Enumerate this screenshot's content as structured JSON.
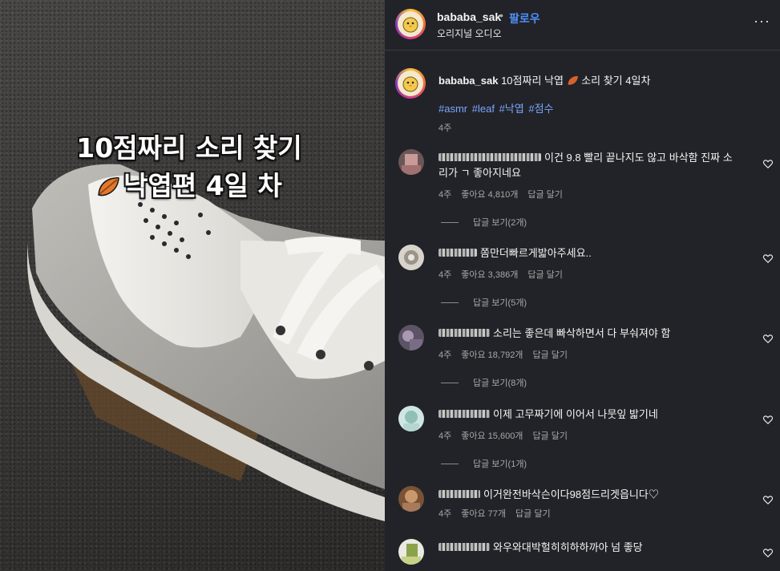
{
  "video": {
    "overlay_line1": "10점짜리 소리 찾기",
    "overlay_line2": "낙엽편 4일 차"
  },
  "header": {
    "username": "bababa_sak",
    "dot": "•",
    "follow_label": "팔로우",
    "audio_label": "오리지널 오디오",
    "more_label": "···"
  },
  "caption": {
    "username": "bababa_sak",
    "text_before": "10점짜리 낙엽",
    "text_after": "소리 찾기 4일차",
    "hashtags": [
      "#asmr",
      "#leaf",
      "#낙엽",
      "#점수"
    ],
    "time": "4주"
  },
  "comments": [
    {
      "text_line1": "이건 9.8 빨리 끝나지도 않고 바삭함 진짜 소",
      "text_line2": "리가 ㄱ 좋아지네요",
      "time": "4주",
      "likes": "좋아요 4,810개",
      "reply_label": "답글 달기",
      "view_replies": "답글 보기(2개)",
      "avatar_color": "#b07a7a"
    },
    {
      "text_line1": "쫌만더빠르게밟아주세요..",
      "time": "4주",
      "likes": "좋아요 3,386개",
      "reply_label": "답글 달기",
      "view_replies": "답글 보기(5개)",
      "avatar_color": "#c9c4bc"
    },
    {
      "text_line1": "소리는 좋은데 빠삭하면서 다 부숴져야 함",
      "time": "4주",
      "likes": "좋아요 18,792개",
      "reply_label": "답글 달기",
      "view_replies": "답글 보기(8개)",
      "avatar_color": "#8d7e93"
    },
    {
      "text_line1": "이제 고무짜기에 이어서 나뭇잎 밟기네",
      "time": "4주",
      "likes": "좋아요 15,600개",
      "reply_label": "답글 달기",
      "view_replies": "답글 보기(1개)",
      "avatar_color": "#9fc7c0"
    },
    {
      "text_line1": "이거완전바삭슨이다98점드리겟읍니다♡",
      "time": "4주",
      "likes": "좋아요 77개",
      "reply_label": "답글 달기",
      "avatar_color": "#a77a5a"
    },
    {
      "text_line1": "와우와대박헐히히하하까아 넘 좋당",
      "avatar_color": "#8aa34a"
    }
  ]
}
